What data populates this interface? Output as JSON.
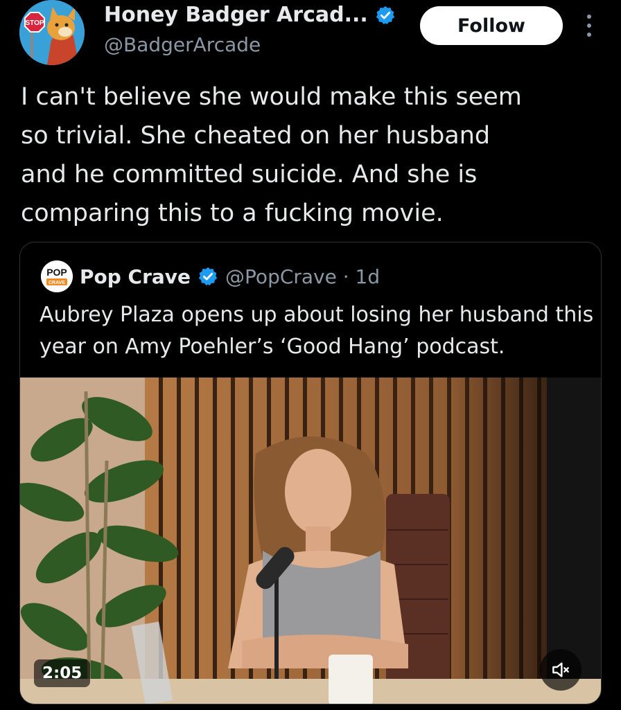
{
  "author": {
    "display_name": "Honey Badger Arcad...",
    "handle": "@BadgerArcade",
    "avatar_sign": "STOP",
    "verified": true
  },
  "actions": {
    "follow_label": "Follow",
    "more_icon": "more-vertical-icon"
  },
  "post": {
    "text": "I can't believe she would make this seem\nso trivial. She cheated on her husband\nand he committed suicide. And she is\ncomparing this to a fucking movie."
  },
  "quoted": {
    "name": "Pop Crave",
    "handle_time": "@PopCrave · 1d",
    "avatar_text_top": "POP",
    "avatar_text_bottom": "CRAVE",
    "verified": true,
    "text": "Aubrey Plaza opens up about losing her husband this year on Amy Poehler’s ‘Good Hang’ podcast.",
    "video": {
      "duration": "2:05",
      "mute_icon": "speaker-muted-icon"
    }
  },
  "colors": {
    "background": "#000000",
    "text": "#e7e9ea",
    "secondary_text": "#8b98a5",
    "verified_blue": "#1d9bf0",
    "border": "#2f3336"
  }
}
